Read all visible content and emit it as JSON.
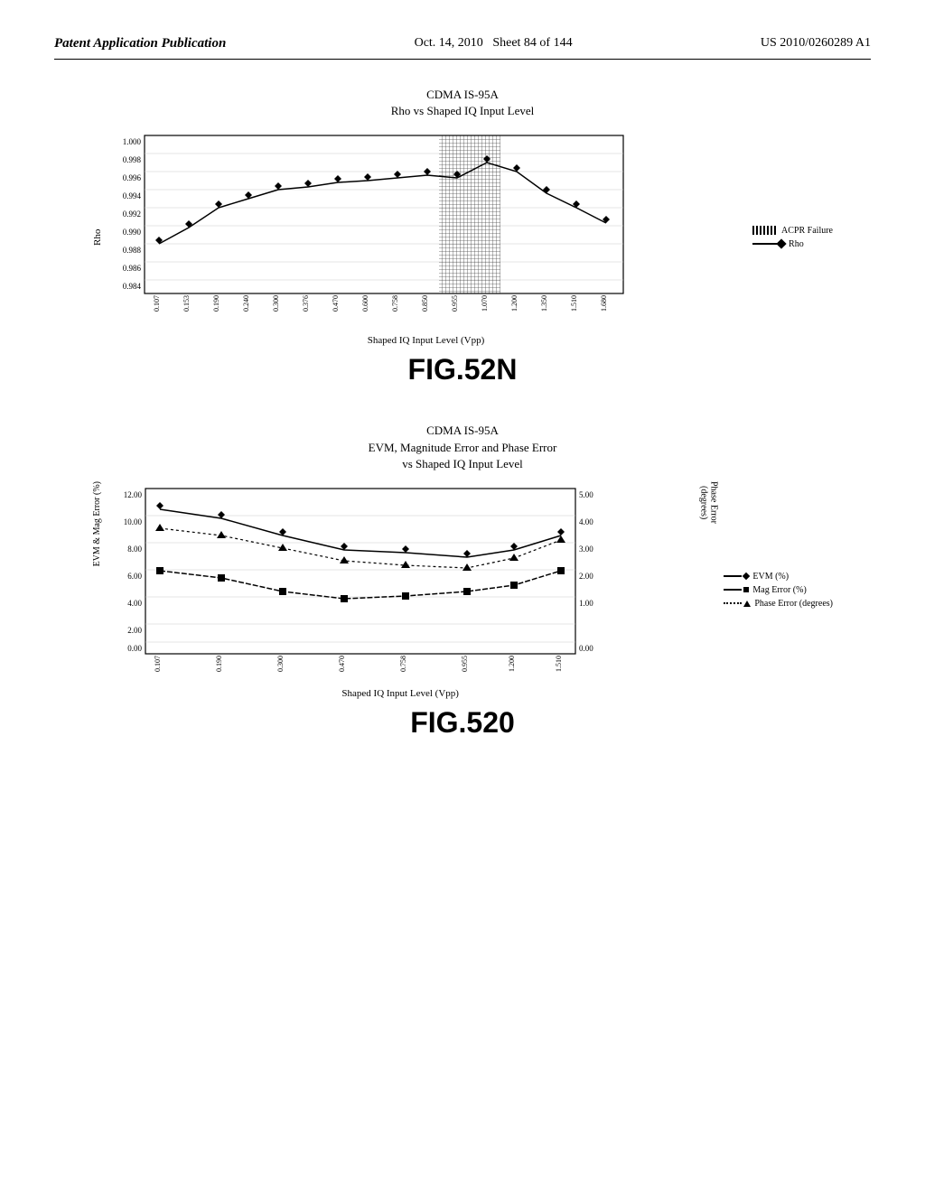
{
  "header": {
    "left": "Patent Application Publication",
    "center": "Oct. 14, 2010",
    "sheet": "Sheet 84 of 144",
    "right": "US 2010/0260289 A1"
  },
  "chart1": {
    "title_line1": "CDMA IS-95A",
    "title_line2": "Rho vs Shaped IQ Input Level",
    "y_label": "Rho",
    "x_label": "Shaped IQ Input Level (Vpp)",
    "y_ticks": [
      "1.000",
      "0.998",
      "0.996",
      "0.994",
      "0.992",
      "0.990",
      "0.988",
      "0.986",
      "0.984"
    ],
    "x_ticks": [
      "0.107",
      "0.153",
      "0.190",
      "0.240",
      "0.300",
      "0.376",
      "0.470",
      "0.600",
      "0.758",
      "0.850",
      "0.955",
      "1.070",
      "1.200",
      "1.350",
      "1.510",
      "1.680"
    ],
    "legend": {
      "acpr": "ACPR Failure",
      "rho": "Rho"
    },
    "fig_label": "FIG.52N"
  },
  "chart2": {
    "title_line1": "CDMA IS-95A",
    "title_line2": "EVM, Magnitude Error and Phase Error",
    "title_line3": "vs Shaped IQ Input Level",
    "y_label_left": "EVM & Mag Error (%)",
    "y_label_right": "Phase Error (degrees)",
    "x_label": "Shaped IQ Input Level (Vpp)",
    "y_ticks_left": [
      "12.00",
      "10.00",
      "8.00",
      "6.00",
      "4.00",
      "2.00",
      "0.00"
    ],
    "y_ticks_right": [
      "5.00",
      "4.00",
      "3.00",
      "2.00",
      "1.00",
      "0.00"
    ],
    "x_ticks": [
      "0.107",
      "0.190",
      "0.300",
      "0.470",
      "0.758",
      "0.955",
      "1.200",
      "1.510"
    ],
    "legend": {
      "evm": "EVM (%)",
      "mag": "Mag Error (%)",
      "phase": "Phase Error (degrees)"
    },
    "fig_label": "FIG.520"
  }
}
